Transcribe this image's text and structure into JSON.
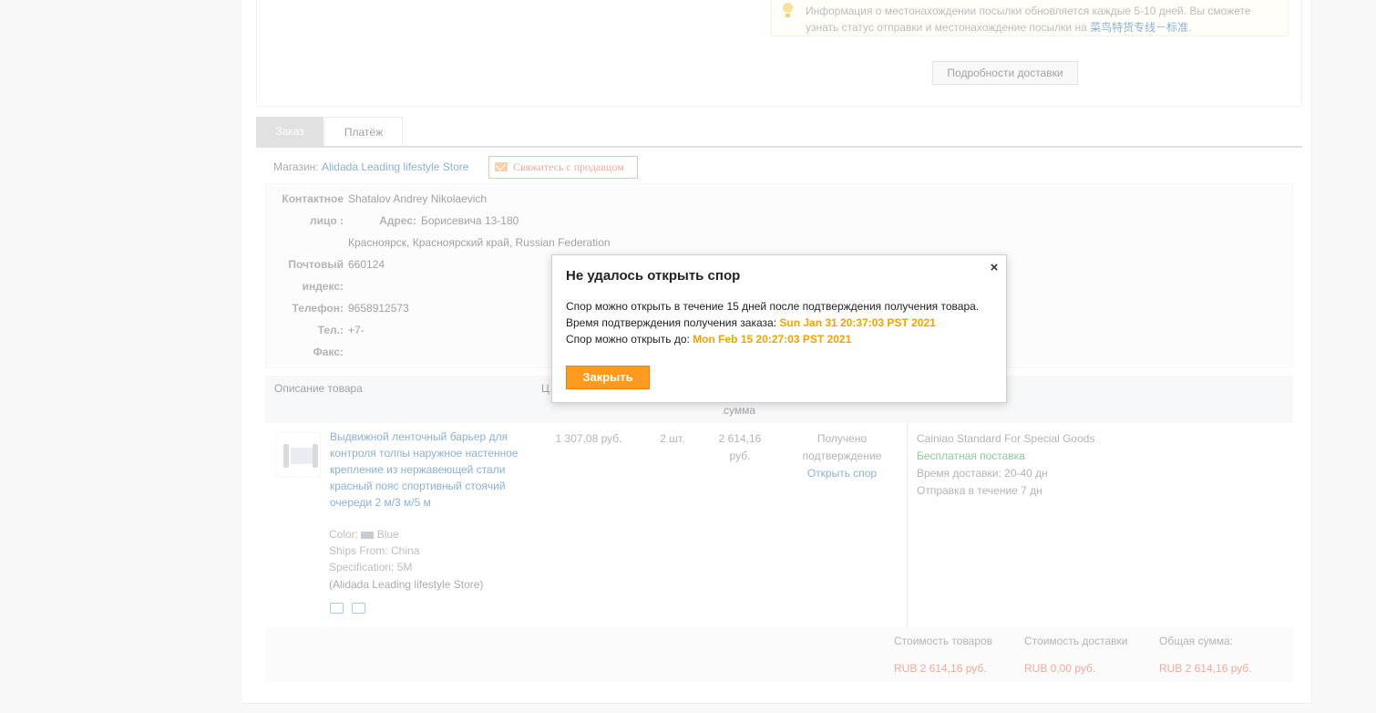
{
  "shipping": {
    "info_text": "Информация о местонахождении посылки обновляется каждые 5-10 дней. Вы сможете узнать статус отправки и местонахождение посылки на ",
    "info_link": "菜鸟特货专线－标准",
    "info_tail": ".",
    "details_button": "Подробности доставки"
  },
  "tabs": {
    "order": "Заказ",
    "payment": "Платёж"
  },
  "store": {
    "label": "Магазин:",
    "name": "Alidada Leading lifestyle Store",
    "contact_seller": "Свяжитесь с продавцом"
  },
  "address": {
    "contact_label_1": "Контактное",
    "contact_label_2": "лицо :",
    "contact_name": "Shatalov Andrey Nikolaevich",
    "address_label": "Адрес:",
    "address_line1": "Борисевича 13-180",
    "address_line2": "Красноярск, Красноярский край, Russian Federation",
    "postal_label_1": "Почтовый",
    "postal_label_2": "индекс:",
    "postal_value": "660124",
    "phone_label": "Телефон:",
    "phone_value": "9658912573",
    "tel_label": "Тел.:",
    "tel_value": "+7-",
    "fax_label": "Факс:"
  },
  "table": {
    "col_description": "Описание товара",
    "col_price_partial": "Ц",
    "col_sum_partial": "сумма"
  },
  "product": {
    "title": "Выдвижной ленточный барьер для контроля толпы наружное настенное крепление из нержавеющей стали красный пояс спортивный стоячий очереди 2 м/3 м/5 м",
    "color": "Color:",
    "color_value": "Blue",
    "ships_from": "Ships From: China",
    "specification": "Specification: 5M",
    "store": "(Alidada Leading lifestyle Store)",
    "price": "1 307,08 руб.",
    "quantity": "2 шт.",
    "sum_line1": "2 614,16",
    "sum_line2": "руб.",
    "status_line1": "Получено",
    "status_line2": "подтверждение",
    "dispute_link": "Открыть спор",
    "shipping_method": "Cainiao Standard For Special Goods",
    "free_shipping": "Бесплатная поставка",
    "delivery_time": "Время доставки: 20-40 дн",
    "dispatch": "Отправка в течение 7 дн"
  },
  "totals": {
    "goods_label": "Стоимость товаров",
    "shipping_label": "Стоимость доставки",
    "total_label": "Общая сумма:",
    "goods_value": "RUB 2 614,16 руб.",
    "shipping_value": "RUB 0,00 руб.",
    "total_value": "RUB 2 614,16 руб."
  },
  "modal": {
    "title": "Не удалось открыть спор",
    "line1": "Спор можно открыть в течение 15 дней после подтверждения получения товара.",
    "line2_label": "Время подтверждения получения заказа: ",
    "line2_value": "Sun Jan 31 20:37:03 PST 2021",
    "line3_label": "Спор можно открыть до: ",
    "line3_value": "Mon Feb 15 20:27:03 PST 2021",
    "close_button": "Закрыть",
    "close_icon": "×"
  },
  "colors": {
    "accent_orange": "#ff9a1e",
    "highlight_date": "#f5a200",
    "link_blue": "#2c6fb5",
    "price_red": "#e4634a",
    "free_green": "#2aa34a"
  },
  "icons": [
    "bulb-icon",
    "mail-icon",
    "close-icon",
    "delivery-truck-icon",
    "card-icon"
  ]
}
